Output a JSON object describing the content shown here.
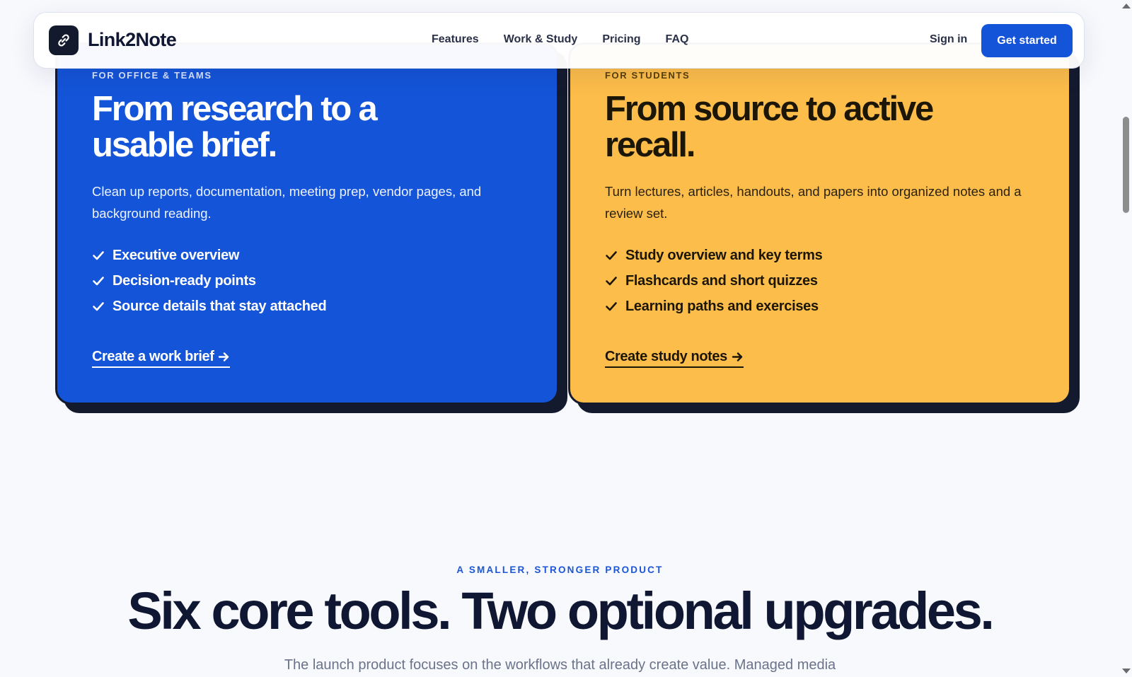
{
  "header": {
    "brand": "Link2Note",
    "nav": [
      "Features",
      "Work & Study",
      "Pricing",
      "FAQ"
    ],
    "sign_in": "Sign in",
    "cta": "Get started"
  },
  "cards": {
    "work": {
      "eyebrow": "FOR OFFICE & TEAMS",
      "title_line1": "From research to a",
      "title_line2": "usable brief.",
      "description": "Clean up reports, documentation, meeting prep, vendor pages, and background reading.",
      "features": [
        "Executive overview",
        "Decision-ready points",
        "Source details that stay attached"
      ],
      "link": "Create a work brief"
    },
    "study": {
      "eyebrow": "FOR STUDENTS",
      "title_line1": "From source to active",
      "title_line2": "recall.",
      "description": "Turn lectures, articles, handouts, and papers into organized notes and a review set.",
      "features": [
        "Study overview and key terms",
        "Flashcards and short quizzes",
        "Learning paths and exercises"
      ],
      "link": "Create study notes"
    }
  },
  "section": {
    "eyebrow": "A SMALLER, STRONGER PRODUCT",
    "title": "Six core tools. Two optional upgrades.",
    "subtitle": "The launch product focuses on the workflows that already create value. Managed media"
  },
  "colors": {
    "primary": "#1454d8",
    "accent_yellow": "#fdbd4a",
    "ink": "#0f1733"
  },
  "icons": {
    "logo": "chain-link-icon",
    "check": "checkmark-icon",
    "arrow": "arrow-right-icon"
  }
}
